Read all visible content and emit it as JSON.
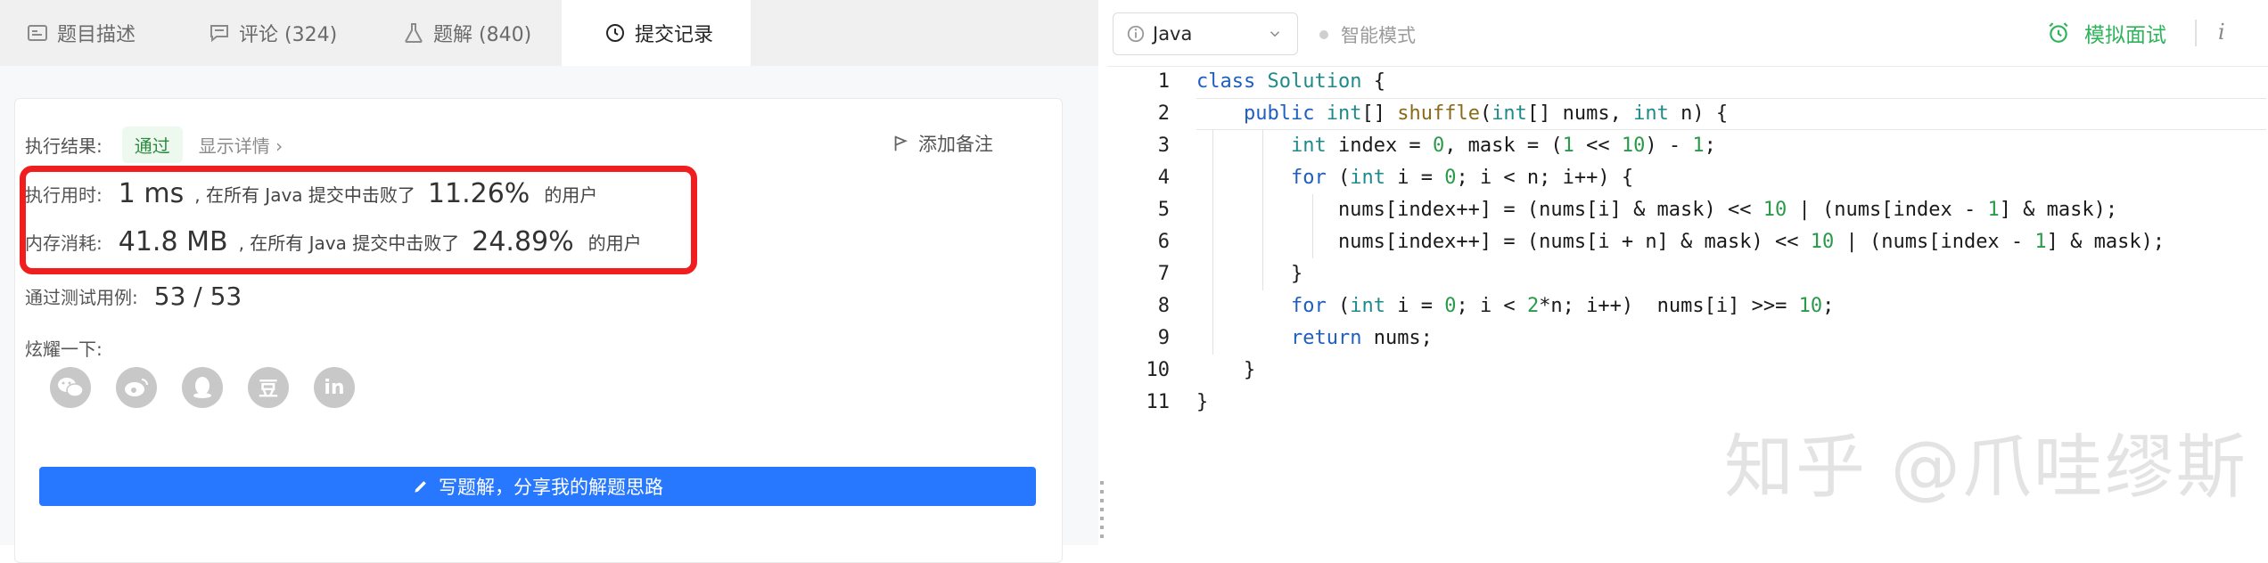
{
  "tabs": [
    {
      "label": "题目描述",
      "icon": "description-icon"
    },
    {
      "label": "评论 (324)",
      "icon": "comment-icon"
    },
    {
      "label": "题解 (840)",
      "icon": "flask-icon"
    },
    {
      "label": "提交记录",
      "icon": "clock-icon"
    }
  ],
  "result": {
    "label": "执行结果:",
    "status": "通过",
    "detail_link": "显示详情 ›",
    "add_note": "添加备注"
  },
  "runtime": {
    "label": "执行用时:",
    "value": "1 ms",
    "prefix": ", 在所有 Java 提交中击败了",
    "percent": "11.26%",
    "suffix": "的用户"
  },
  "memory": {
    "label": "内存消耗:",
    "value": "41.8 MB",
    "prefix": ", 在所有 Java 提交中击败了",
    "percent": "24.89%",
    "suffix": "的用户"
  },
  "tests": {
    "label": "通过测试用例:",
    "value": "53 / 53"
  },
  "share": {
    "label": "炫耀一下:",
    "icons": [
      "wechat-icon",
      "weibo-icon",
      "qq-icon",
      "douban-icon",
      "linkedin-icon"
    ],
    "douban_text": "豆",
    "linkedin_text": "in"
  },
  "write_button": "写题解，分享我的解题思路",
  "editor": {
    "language": "Java",
    "smart_mode": "智能模式",
    "mock_interview": "模拟面试",
    "info": "i",
    "line_numbers": [
      "1",
      "2",
      "3",
      "4",
      "5",
      "6",
      "7",
      "8",
      "9",
      "10",
      "11"
    ],
    "code_lines": [
      "class Solution {",
      "    public int[] shuffle(int[] nums, int n) {",
      "        int index = 0, mask = (1 << 10) - 1;",
      "        for (int i = 0; i < n; i++) {",
      "            nums[index++] = (nums[i] & mask) << 10 | (nums[index - 1] & mask);",
      "            nums[index++] = (nums[i + n] & mask) << 10 | (nums[index - 1] & mask);",
      "        }",
      "        for (int i = 0; i < 2*n; i++)  nums[i] >>= 10;",
      "        return nums;",
      "    }",
      "}"
    ]
  },
  "watermark": "知乎 @爪哇缪斯",
  "colors": {
    "accent": "#2878ff",
    "pass": "#2b8a3e",
    "highlight_box": "#f01e1e",
    "mock": "#2fb35b"
  }
}
